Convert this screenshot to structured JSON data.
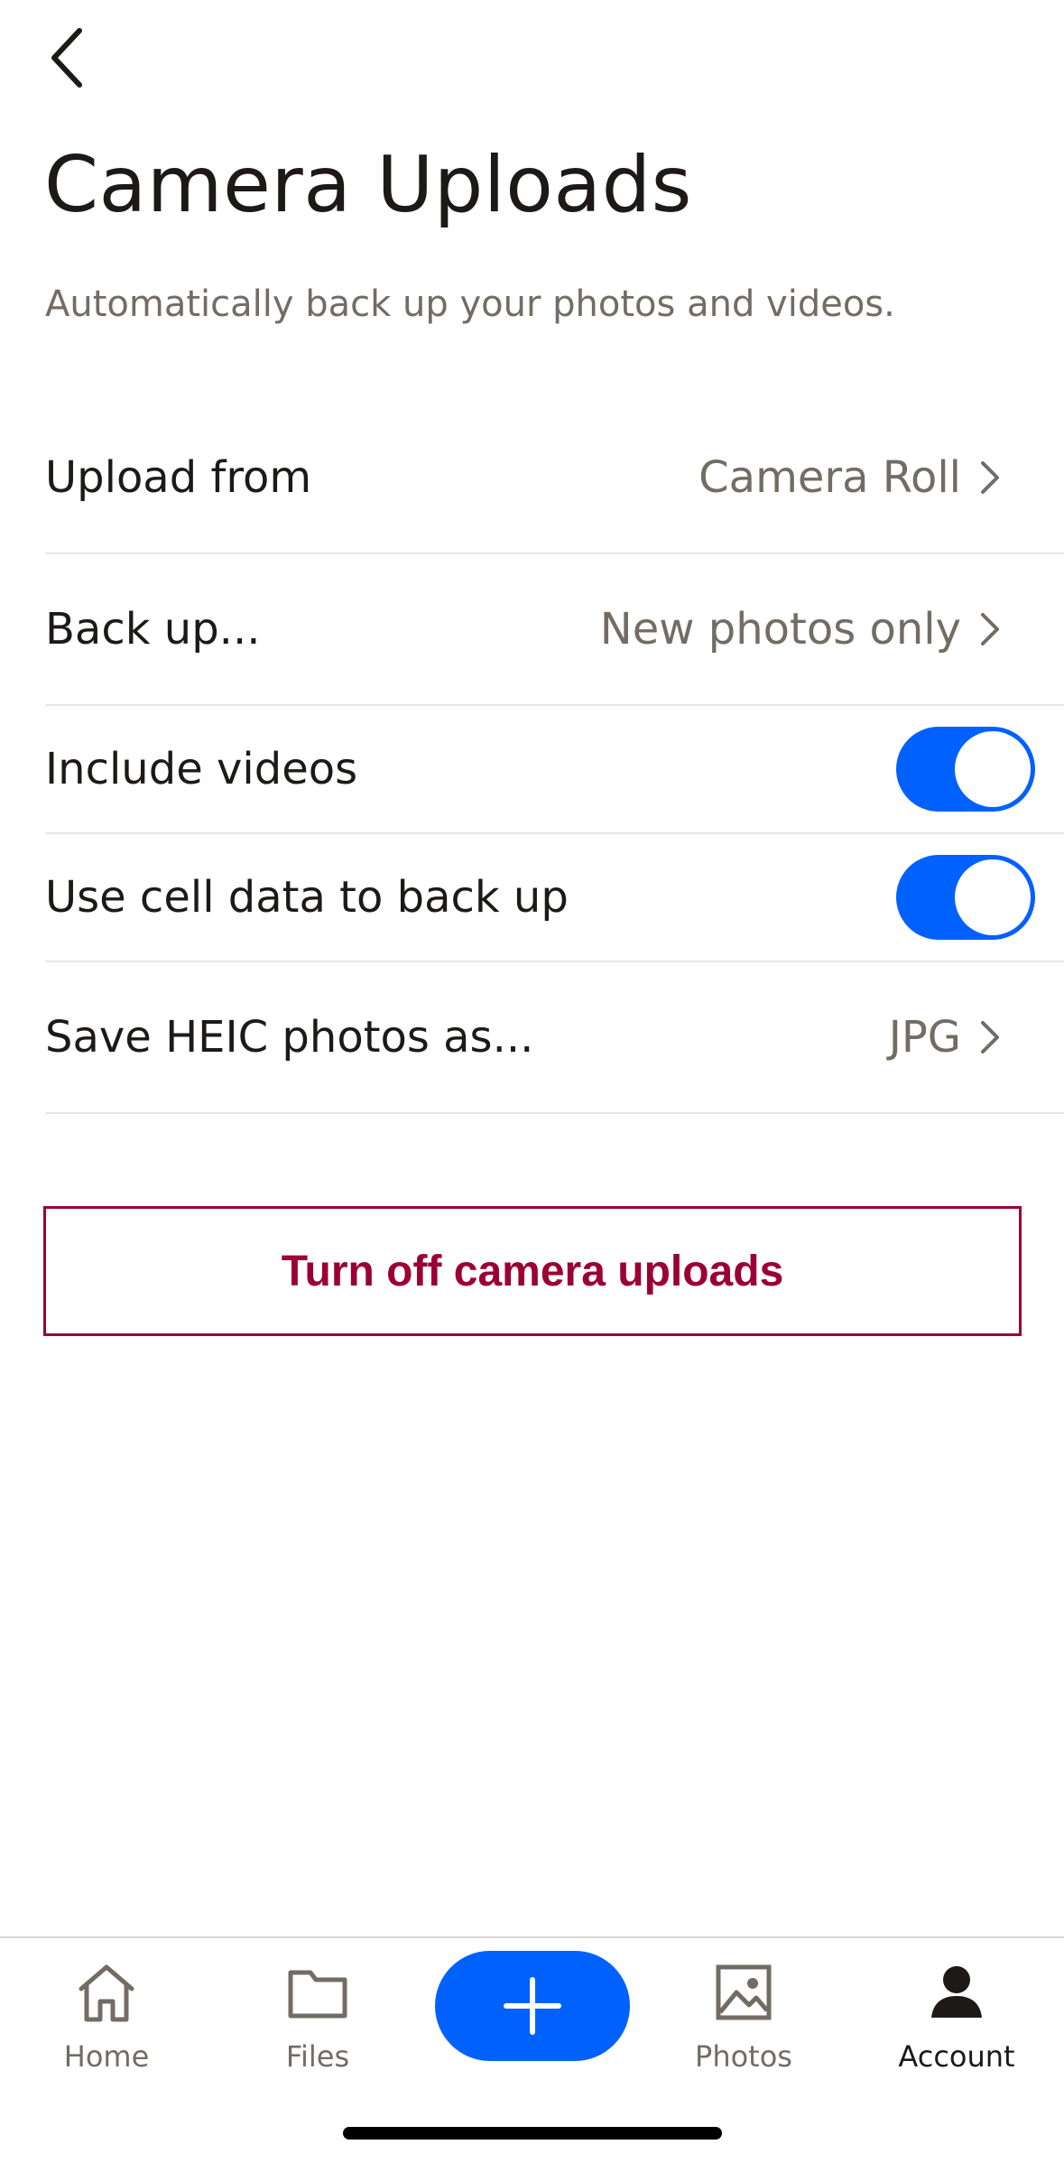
{
  "header": {
    "back_icon": "chevron-left-icon",
    "title": "Camera Uploads",
    "subtitle": "Automatically back up your photos and videos."
  },
  "settings": {
    "upload_from": {
      "label": "Upload from",
      "value": "Camera Roll"
    },
    "back_up": {
      "label": "Back up...",
      "value": "New photos only"
    },
    "include_videos": {
      "label": "Include videos",
      "enabled": true
    },
    "cell_data": {
      "label": "Use cell data to back up",
      "enabled": true
    },
    "heic": {
      "label": "Save HEIC photos as...",
      "value": "JPG"
    }
  },
  "actions": {
    "turn_off_label": "Turn off camera uploads"
  },
  "tabbar": {
    "home": "Home",
    "files": "Files",
    "photos": "Photos",
    "account": "Account",
    "active": "account"
  },
  "colors": {
    "accent": "#0061fe",
    "danger": "#9b0032",
    "secondary_text": "#736c64"
  }
}
